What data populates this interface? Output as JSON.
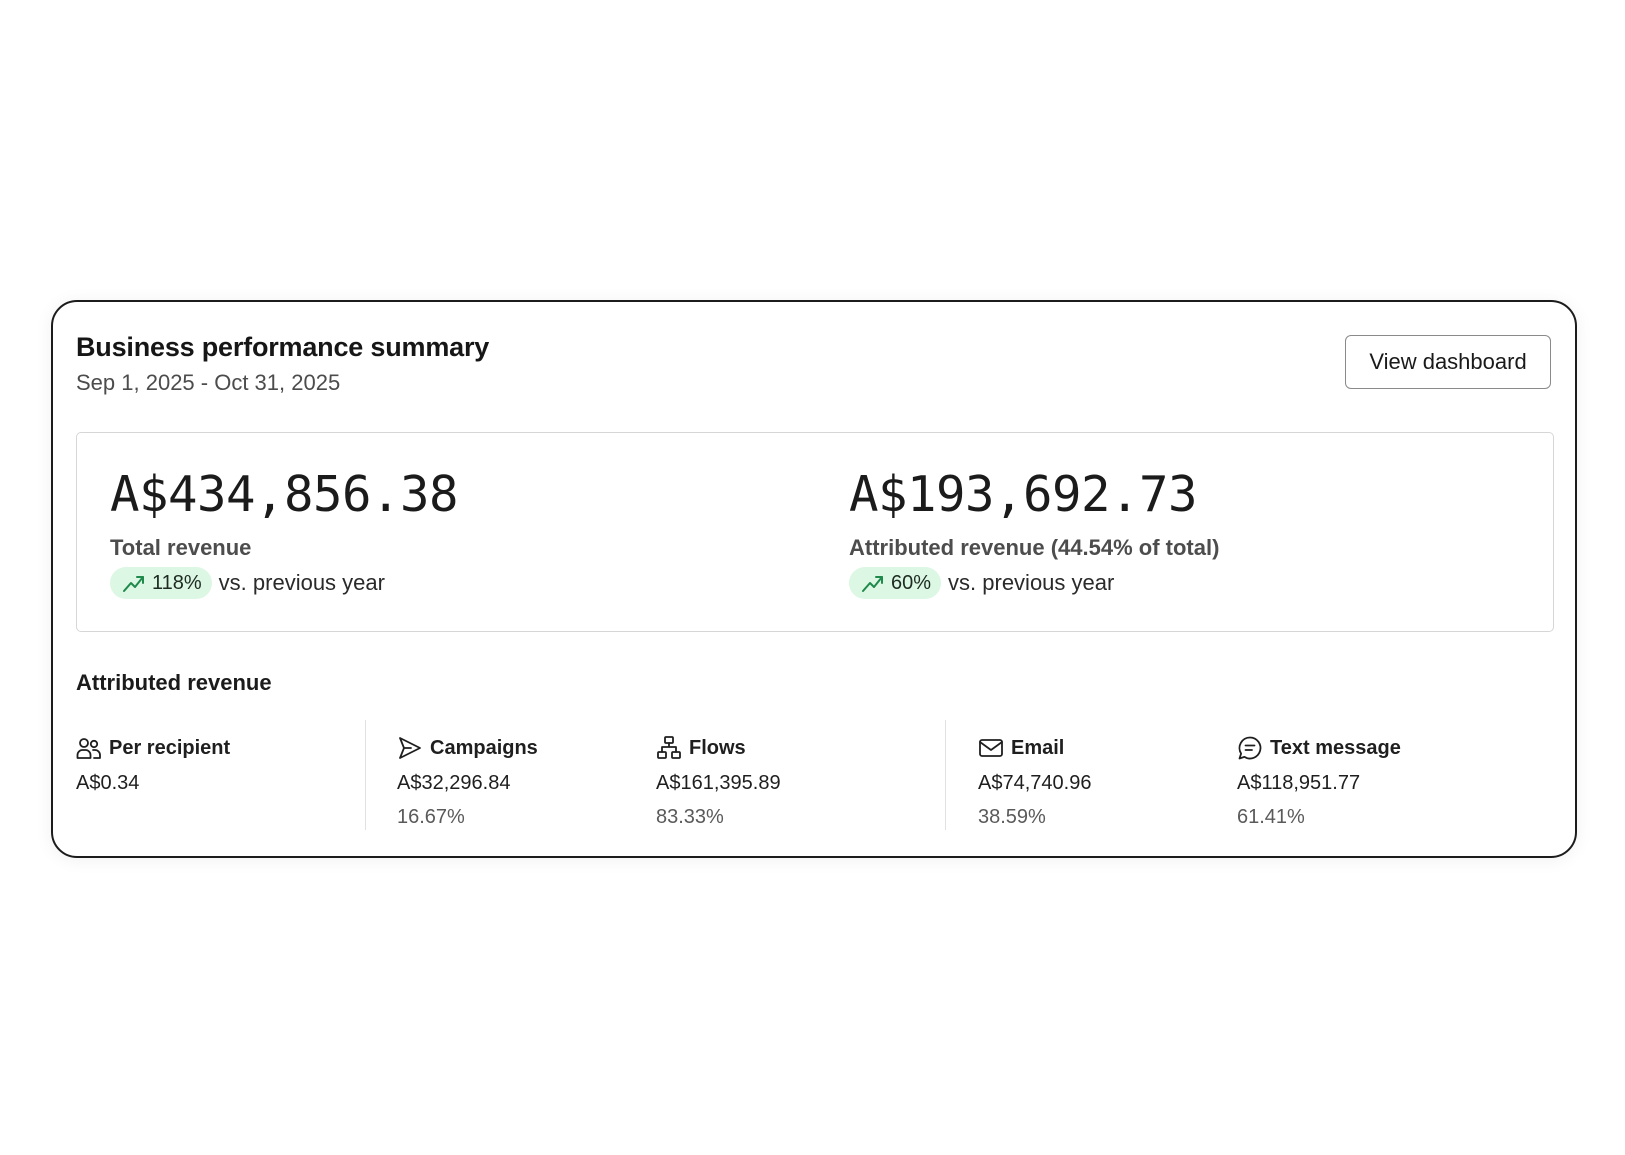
{
  "summary": {
    "title": "Business performance summary",
    "date_range": "Sep 1, 2025 - Oct 31, 2025",
    "view_dashboard_label": "View dashboard"
  },
  "totals": [
    {
      "value": "A$434,856.38",
      "label": "Total revenue",
      "trend_icon": "trending-up-icon",
      "trend_value": "118%",
      "trend_suffix": "vs. previous year"
    },
    {
      "value": "A$193,692.73",
      "label": "Attributed revenue (44.54% of total)",
      "trend_icon": "trending-up-icon",
      "trend_value": "60%",
      "trend_suffix": "vs. previous year"
    }
  ],
  "attributed": {
    "title": "Attributed revenue",
    "per_recipient": {
      "icon": "users-icon",
      "label": "Per recipient",
      "value": "A$0.34"
    },
    "campaigns": {
      "icon": "send-icon",
      "label": "Campaigns",
      "value": "A$32,296.84",
      "percent": "16.67%"
    },
    "flows": {
      "icon": "flow-icon",
      "label": "Flows",
      "value": "A$161,395.89",
      "percent": "83.33%"
    },
    "email": {
      "icon": "mail-icon",
      "label": "Email",
      "value": "A$74,740.96",
      "percent": "38.59%"
    },
    "text_message": {
      "icon": "message-icon",
      "label": "Text message",
      "value": "A$118,951.77",
      "percent": "61.41%"
    }
  },
  "colors": {
    "trend_badge_bg": "#dcf7e3",
    "trend_icon": "#1f8a4c",
    "card_border": "#1c1c1c"
  }
}
